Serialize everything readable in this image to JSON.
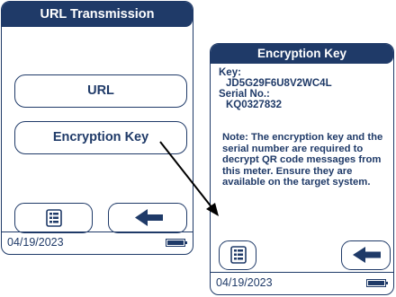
{
  "screen1": {
    "title": "URL Transmission",
    "url_label": "URL",
    "encryption_key_label": "Encryption Key",
    "date": "04/19/2023"
  },
  "screen2": {
    "title": "Encryption Key",
    "key_label": "Key:",
    "key_value": "JD5G29F6U8V2WC4L",
    "serial_label": "Serial No.:",
    "serial_value": "KQ0327832",
    "note": "Note: The encryption key and the serial number are required to decrypt QR code messages from this meter. Ensure they are available on the target system.",
    "date": "04/19/2023"
  },
  "icons": [
    "menu-icon",
    "back-arrow-icon",
    "battery-icon",
    "connector-arrow-icon"
  ],
  "colors": {
    "primary": "#1f3a68",
    "background": "#ffffff"
  }
}
